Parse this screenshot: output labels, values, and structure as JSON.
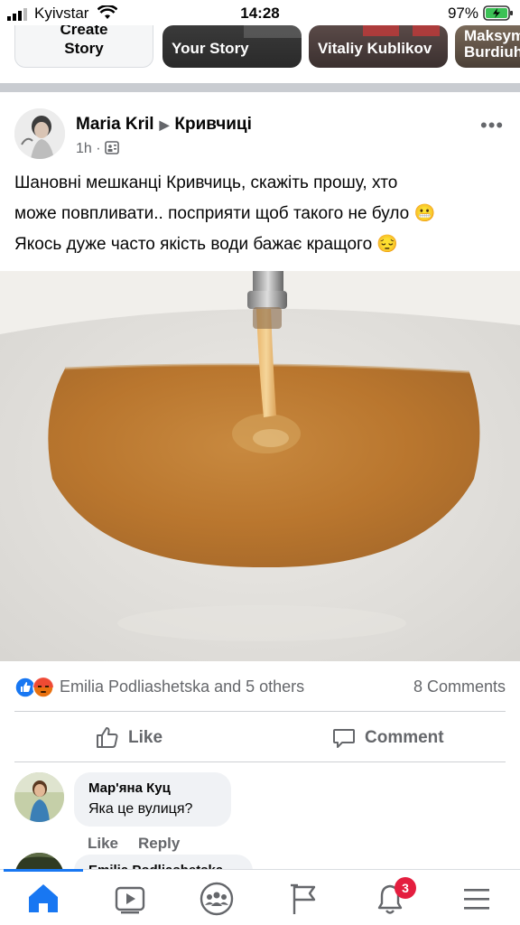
{
  "status_bar": {
    "carrier": "Kyivstar",
    "time": "14:28",
    "battery": "97%"
  },
  "stories": {
    "create_label_line1": "Create",
    "create_label_line2": "Story",
    "items": [
      {
        "name": "Your Story"
      },
      {
        "name": "Vitaliy Kublikov"
      },
      {
        "name": "Maksym Burdiuh"
      }
    ]
  },
  "post": {
    "author": "Maria Kril",
    "group": "Кривчиці",
    "time": "1h",
    "text_line1": "Шановні мешканці Кривчиць, скажіть прошу, хто",
    "text_line2": "може повпливати.. посприяти щоб такого не було 😬",
    "text_line3": "Якось дуже часто якість води бажає кращого 😔",
    "reactions_text": "Emilia Podliashetska and 5 others",
    "comments_count": "8 Comments",
    "like_label": "Like",
    "comment_label": "Comment"
  },
  "comments": [
    {
      "author": "Мар'яна Куц",
      "text": "Яка це вулиця?",
      "like_label": "Like",
      "reply_label": "Reply"
    },
    {
      "author": "Emilia Podliashetska"
    }
  ],
  "tabbar": {
    "notifications_badge": "3",
    "accent": "#1877f2"
  }
}
